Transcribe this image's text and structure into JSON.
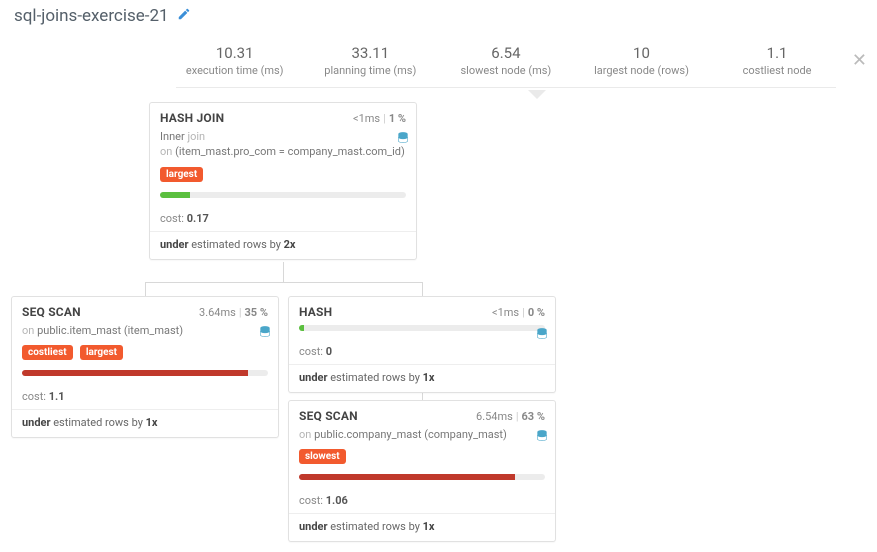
{
  "title": "sql-joins-exercise-21",
  "stats": [
    {
      "value": "10.31",
      "label": "execution time (ms)"
    },
    {
      "value": "33.11",
      "label": "planning time (ms)"
    },
    {
      "value": "6.54",
      "label": "slowest node (ms)"
    },
    {
      "value": "10",
      "label": "largest node (rows)"
    },
    {
      "value": "1.1",
      "label": "costliest node"
    }
  ],
  "nodes": {
    "hashjoin": {
      "name": "HASH JOIN",
      "time": "<1ms",
      "pct": "1 %",
      "line1_a": "Inner ",
      "line1_b": "join",
      "line2_a": "on ",
      "line2_b": "(item_mast.pro_com = company_mast.com_id)",
      "tags": [
        "largest"
      ],
      "bar_color": "#5bbf3f",
      "bar_width": "12%",
      "cost": "0.17",
      "est_prefix": "under",
      "est_mid": " estimated rows by ",
      "est_x": "2x"
    },
    "seq1": {
      "name": "SEQ SCAN",
      "time": "3.64ms",
      "pct": "35 %",
      "on_a": "on ",
      "on_b": "public.item_mast (item_mast)",
      "tags": [
        "costliest",
        "largest"
      ],
      "bar_color": "#c0392b",
      "bar_width": "92%",
      "cost": "1.1",
      "est_prefix": "under",
      "est_mid": " estimated rows by ",
      "est_x": "1x"
    },
    "hash": {
      "name": "HASH",
      "time": "<1ms",
      "pct": "0 %",
      "bar_color": "#5bbf3f",
      "bar_width": "2%",
      "cost": "0",
      "est_prefix": "under",
      "est_mid": " estimated rows by ",
      "est_x": "1x"
    },
    "seq2": {
      "name": "SEQ SCAN",
      "time": "6.54ms",
      "pct": "63 %",
      "on_a": "on ",
      "on_b": "public.company_mast (company_mast)",
      "tags": [
        "slowest"
      ],
      "bar_color": "#c0392b",
      "bar_width": "88%",
      "cost": "1.06",
      "est_prefix": "under",
      "est_mid": " estimated rows by ",
      "est_x": "1x"
    }
  },
  "labels": {
    "cost": "cost: "
  }
}
